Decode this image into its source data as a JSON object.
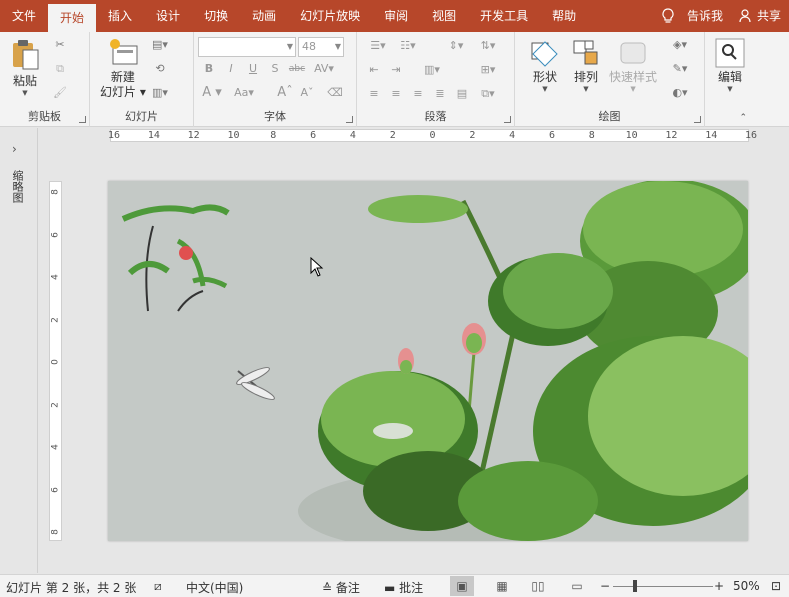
{
  "menu": {
    "items": [
      "文件",
      "开始",
      "插入",
      "设计",
      "切换",
      "动画",
      "幻灯片放映",
      "审阅",
      "视图",
      "开发工具",
      "帮助"
    ],
    "active_index": 1,
    "tell_me": "告诉我",
    "share": "共享"
  },
  "ribbon": {
    "clipboard": {
      "label": "剪贴板",
      "paste": "粘贴"
    },
    "slides": {
      "label": "幻灯片",
      "new_slide_line1": "新建",
      "new_slide_line2": "幻灯片"
    },
    "font": {
      "label": "字体",
      "font_size": "48"
    },
    "paragraph": {
      "label": "段落"
    },
    "drawing": {
      "label": "绘图",
      "shapes": "形状",
      "arrange": "排列",
      "quick_styles": "快速样式"
    },
    "editing": {
      "label": "编辑"
    }
  },
  "rulers": {
    "horizontal": [
      "16",
      "14",
      "12",
      "10",
      "8",
      "6",
      "4",
      "2",
      "0",
      "2",
      "4",
      "6",
      "8",
      "10",
      "12",
      "14",
      "16"
    ],
    "vertical": [
      "8",
      "6",
      "4",
      "2",
      "0",
      "2",
      "4",
      "6",
      "8"
    ]
  },
  "thumbnail_panel": {
    "title": "缩略图"
  },
  "statusbar": {
    "slide_info": "幻灯片 第 2 张，共 2 张",
    "language": "中文(中国)",
    "notes": "备注",
    "comments": "批注",
    "zoom": "50%"
  },
  "colors": {
    "accent": "#b7472a",
    "ribbon_bg": "#f3f3f3",
    "app_bg": "#e6e6e6"
  }
}
